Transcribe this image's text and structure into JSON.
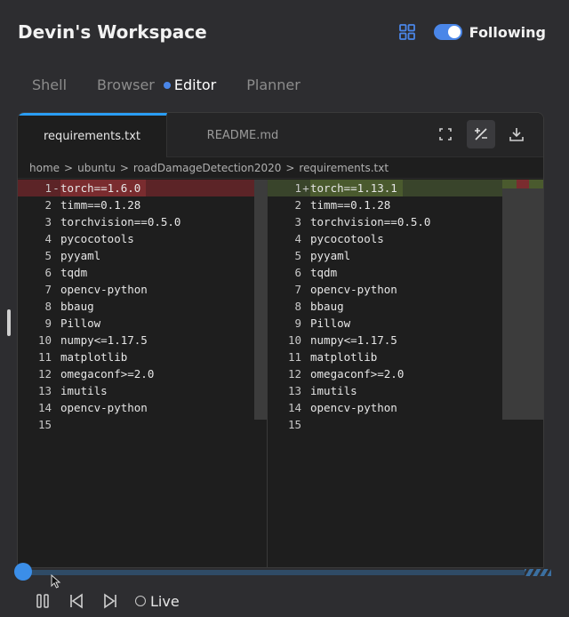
{
  "header": {
    "title": "Devin's Workspace",
    "following_label": "Following",
    "following_on": true
  },
  "tabs": [
    {
      "label": "Shell",
      "active": false
    },
    {
      "label": "Browser",
      "active": false
    },
    {
      "label": "Editor",
      "active": true
    },
    {
      "label": "Planner",
      "active": false
    }
  ],
  "editor": {
    "file_tabs": [
      {
        "label": "requirements.txt",
        "active": true
      },
      {
        "label": "README.md",
        "active": false
      }
    ],
    "breadcrumb": [
      "home",
      "ubuntu",
      "roadDamageDetection2020",
      "requirements.txt"
    ],
    "breadcrumb_separator": ">",
    "left_lines": [
      {
        "n": "1",
        "mark": "-",
        "text": "torch==1.6.0",
        "type": "del"
      },
      {
        "n": "2",
        "mark": "",
        "text": "timm==0.1.28",
        "type": ""
      },
      {
        "n": "3",
        "mark": "",
        "text": "torchvision==0.5.0",
        "type": ""
      },
      {
        "n": "4",
        "mark": "",
        "text": "pycocotools",
        "type": ""
      },
      {
        "n": "5",
        "mark": "",
        "text": "pyyaml",
        "type": ""
      },
      {
        "n": "6",
        "mark": "",
        "text": "tqdm",
        "type": ""
      },
      {
        "n": "7",
        "mark": "",
        "text": "opencv-python",
        "type": ""
      },
      {
        "n": "8",
        "mark": "",
        "text": "bbaug",
        "type": ""
      },
      {
        "n": "9",
        "mark": "",
        "text": "Pillow",
        "type": ""
      },
      {
        "n": "10",
        "mark": "",
        "text": "numpy<=1.17.5",
        "type": ""
      },
      {
        "n": "11",
        "mark": "",
        "text": "matplotlib",
        "type": ""
      },
      {
        "n": "12",
        "mark": "",
        "text": "omegaconf>=2.0",
        "type": ""
      },
      {
        "n": "13",
        "mark": "",
        "text": "imutils",
        "type": ""
      },
      {
        "n": "14",
        "mark": "",
        "text": "opencv-python",
        "type": ""
      },
      {
        "n": "15",
        "mark": "",
        "text": "",
        "type": ""
      }
    ],
    "right_lines": [
      {
        "n": "1",
        "mark": "+",
        "text": "torch==1.13.1",
        "type": "add"
      },
      {
        "n": "2",
        "mark": "",
        "text": "timm==0.1.28",
        "type": ""
      },
      {
        "n": "3",
        "mark": "",
        "text": "torchvision==0.5.0",
        "type": ""
      },
      {
        "n": "4",
        "mark": "",
        "text": "pycocotools",
        "type": ""
      },
      {
        "n": "5",
        "mark": "",
        "text": "pyyaml",
        "type": ""
      },
      {
        "n": "6",
        "mark": "",
        "text": "tqdm",
        "type": ""
      },
      {
        "n": "7",
        "mark": "",
        "text": "opencv-python",
        "type": ""
      },
      {
        "n": "8",
        "mark": "",
        "text": "bbaug",
        "type": ""
      },
      {
        "n": "9",
        "mark": "",
        "text": "Pillow",
        "type": ""
      },
      {
        "n": "10",
        "mark": "",
        "text": "numpy<=1.17.5",
        "type": ""
      },
      {
        "n": "11",
        "mark": "",
        "text": "matplotlib",
        "type": ""
      },
      {
        "n": "12",
        "mark": "",
        "text": "omegaconf>=2.0",
        "type": ""
      },
      {
        "n": "13",
        "mark": "",
        "text": "imutils",
        "type": ""
      },
      {
        "n": "14",
        "mark": "",
        "text": "opencv-python",
        "type": ""
      },
      {
        "n": "15",
        "mark": "",
        "text": "",
        "type": ""
      }
    ]
  },
  "playback": {
    "live_label": "Live",
    "progress": 0.0
  },
  "icons": {
    "grid": "grid-icon",
    "fullscreen": "fullscreen-icon",
    "diff": "diff-icon",
    "download": "download-icon",
    "pause": "pause-icon",
    "skip_back": "skip-back-icon",
    "skip_forward": "skip-forward-icon"
  },
  "colors": {
    "accent": "#4a86e8",
    "tab_underline": "#2a9df4",
    "deleted_line": "#7a2c2f",
    "added_line": "#4a5a2e",
    "background": "#2d2d30",
    "editor_bg": "#1e1e1e"
  }
}
